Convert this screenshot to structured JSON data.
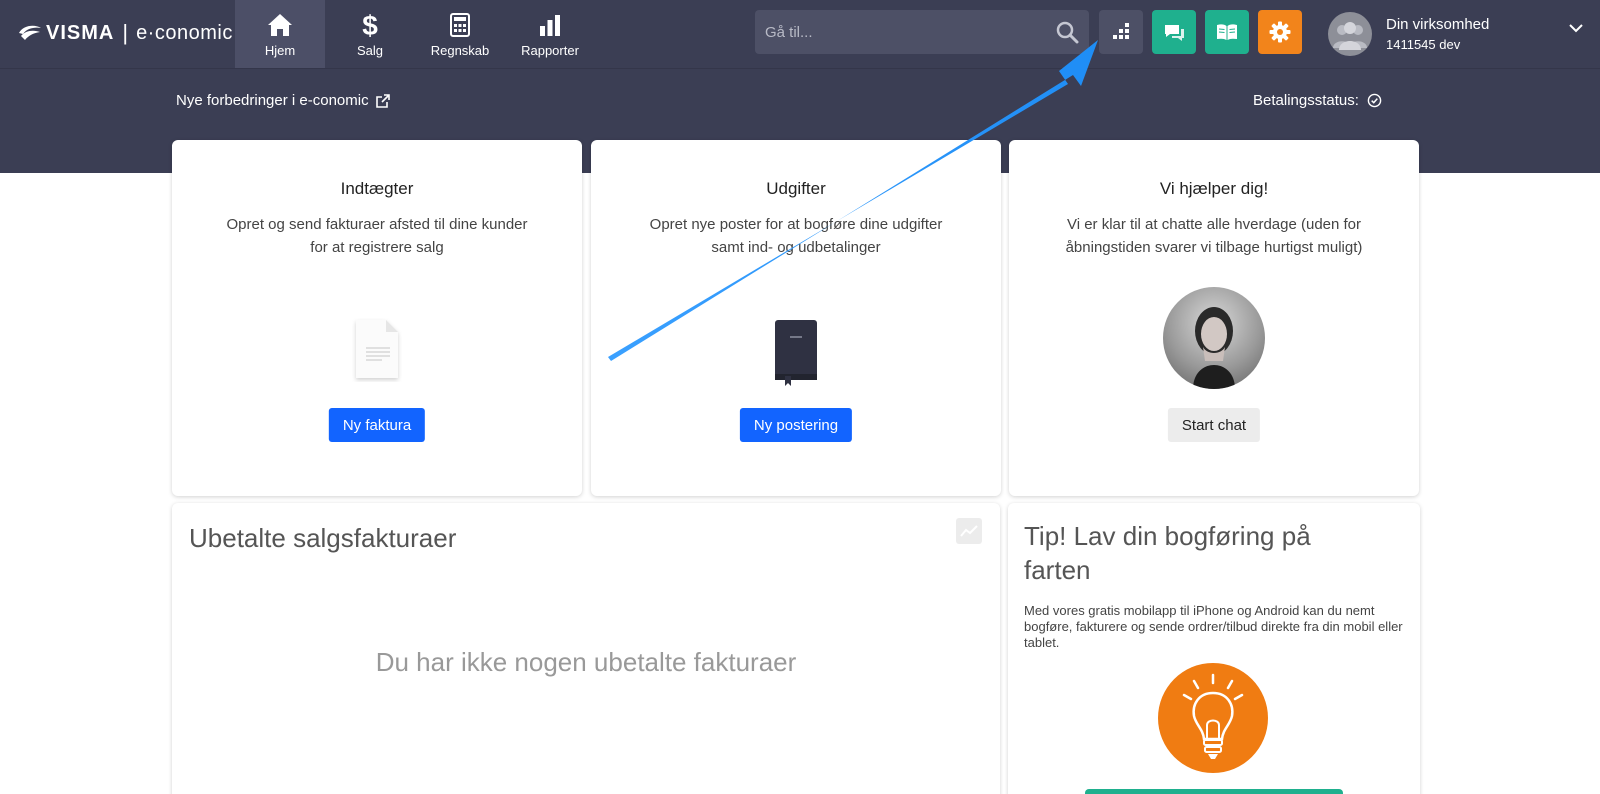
{
  "brand": {
    "mark": "VISMA",
    "sep": "|",
    "product": "e·conomic"
  },
  "nav": {
    "items": [
      {
        "label": "Hjem",
        "icon": "home-icon",
        "active": true
      },
      {
        "label": "Salg",
        "icon": "dollar-icon"
      },
      {
        "label": "Regnskab",
        "icon": "calculator-icon"
      },
      {
        "label": "Rapporter",
        "icon": "bar-chart-icon"
      }
    ]
  },
  "search": {
    "placeholder": "Gå til...",
    "value": ""
  },
  "toolbar": {
    "grid_icon": "apps-grid-icon",
    "chat_icon": "chat-icon",
    "book_icon": "book-icon",
    "gear_icon": "gear-icon",
    "colors": {
      "dark": "#4d5066",
      "teal": "#1fb08e",
      "orange": "#f2841b"
    }
  },
  "user": {
    "company": "Din virksomhed",
    "sub": "1411545 dev"
  },
  "band": {
    "link": "Nye forbedringer i e-conomic",
    "status": "Betalingsstatus:"
  },
  "cards": [
    {
      "title": "Indtægter",
      "line1": "Opret og send fakturaer afsted til dine kunder",
      "line2": "for at registrere salg",
      "button": "Ny faktura"
    },
    {
      "title": "Udgifter",
      "line1": "Opret nye poster for at bogføre dine udgifter",
      "line2": "samt ind- og udbetalinger",
      "button": "Ny postering"
    },
    {
      "title": "Vi hjælper dig!",
      "line1": "Vi er klar til at chatte alle hverdage (uden for",
      "line2": "åbningstiden svarer vi tilbage hurtigst muligt)",
      "button": "Start chat"
    }
  ],
  "unpaid": {
    "title": "Ubetalte salgsfakturaer",
    "empty": "Du har ikke nogen ubetalte fakturaer"
  },
  "tip": {
    "title": "Tip! Lav din bogføring på farten",
    "text": "Med vores gratis mobilapp til iPhone og Android kan du nemt bogføre, fakturere og sende ordrer/tilbud direkte fra din mobil eller tablet."
  },
  "colors": {
    "topbar": "#3b3e54",
    "primary": "#1264ff",
    "arrow": "#1e8df5"
  }
}
